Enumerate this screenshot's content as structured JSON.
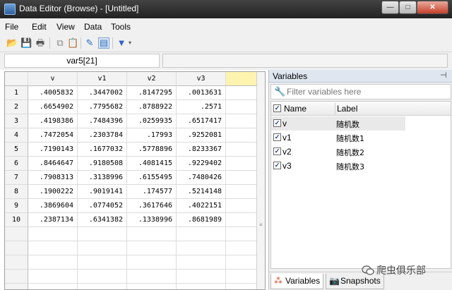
{
  "window": {
    "title": "Data Editor (Browse) - [Untitled]",
    "min_glyph": "—",
    "max_glyph": "□",
    "close_glyph": "✕"
  },
  "menu": [
    "File",
    "Edit",
    "View",
    "Data",
    "Tools"
  ],
  "toolbar": [
    {
      "icon": "open-folder-icon",
      "glyph": "📂"
    },
    {
      "icon": "save-icon",
      "glyph": "💾"
    },
    {
      "icon": "print-icon",
      "glyph": "🖶"
    },
    {
      "icon": "copy-icon",
      "glyph": "⧉"
    },
    {
      "icon": "paste-icon",
      "glyph": "📋"
    },
    {
      "icon": "edit-mode-icon",
      "glyph": "✎"
    },
    {
      "icon": "browse-mode-icon",
      "glyph": "▤"
    },
    {
      "icon": "filter-icon",
      "glyph": "▼"
    },
    {
      "icon": "chevron-down-icon",
      "glyph": "▾"
    }
  ],
  "cell_name": "var5[21]",
  "cell_value": "",
  "grid": {
    "headers": [
      "v",
      "v1",
      "v2",
      "v3"
    ],
    "row_numbers": [
      "1",
      "2",
      "3",
      "4",
      "5",
      "6",
      "7",
      "8",
      "9",
      "10"
    ],
    "rows": [
      [
        ".4005832",
        ".3447002",
        ".8147295",
        ".0013631"
      ],
      [
        ".6654902",
        ".7795682",
        ".8788922",
        ".2571"
      ],
      [
        ".4198386",
        ".7484396",
        ".0259935",
        ".6517417"
      ],
      [
        ".7472054",
        ".2303784",
        ".17993",
        ".9252081"
      ],
      [
        ".7190143",
        ".1677032",
        ".5778896",
        ".8233367"
      ],
      [
        ".8464647",
        ".9180508",
        ".4081415",
        ".9229402"
      ],
      [
        ".7908313",
        ".3138996",
        ".6155495",
        ".7480426"
      ],
      [
        ".1900222",
        ".9019141",
        ".174577",
        ".5214148"
      ],
      [
        ".3869604",
        ".0774052",
        ".3617646",
        ".4022151"
      ],
      [
        ".2387134",
        ".6341382",
        ".1338996",
        ".8681989"
      ]
    ],
    "scroll_grip": "≡"
  },
  "variables_panel": {
    "title": "Variables",
    "pin_glyph": "⊣",
    "filter_icon": "🔧",
    "filter_placeholder": "Filter variables here",
    "col_name": "Name",
    "col_label": "Label",
    "check_glyph": "✓",
    "items": [
      {
        "name": "v",
        "label": "随机数",
        "checked": true
      },
      {
        "name": "v1",
        "label": "随机数1",
        "checked": true
      },
      {
        "name": "v2",
        "label": "随机数2",
        "checked": true
      },
      {
        "name": "v3",
        "label": "随机数3",
        "checked": true
      }
    ],
    "tabs": [
      {
        "label": "Variables",
        "icon": "variables-tab-icon",
        "glyph": "⁂"
      },
      {
        "label": "Snapshots",
        "icon": "camera-icon",
        "glyph": "📷"
      }
    ]
  },
  "watermark": "爬虫俱乐部"
}
